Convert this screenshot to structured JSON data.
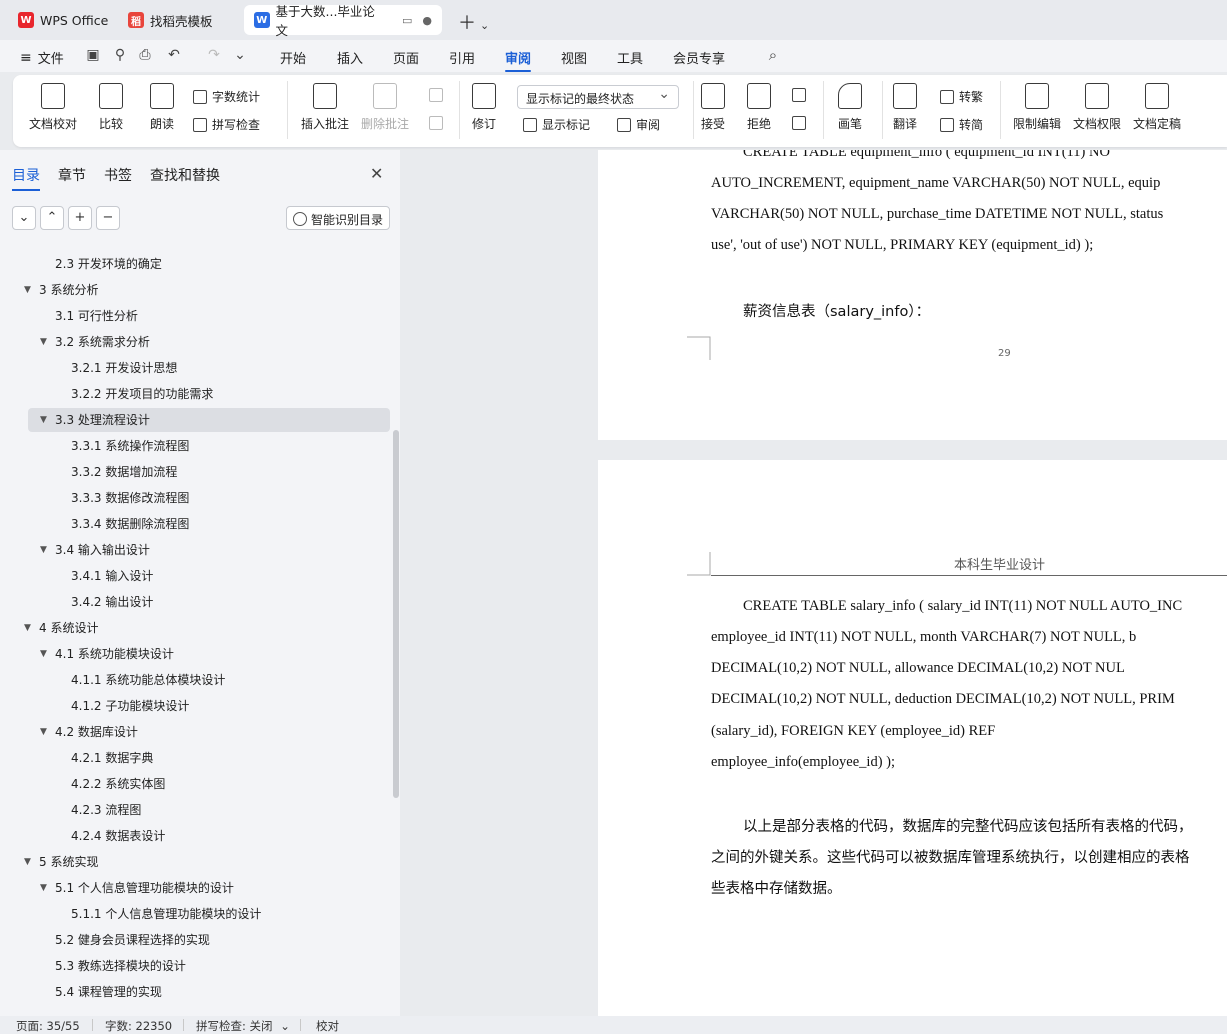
{
  "tabs": [
    {
      "label": "WPS Office",
      "logo": "wps-logo"
    },
    {
      "label": "找稻壳模板",
      "logo": "docer-logo"
    },
    {
      "label": "基于大数...毕业论文",
      "logo": "writer-logo"
    }
  ],
  "menu": {
    "file": "文件",
    "items": [
      "开始",
      "插入",
      "页面",
      "引用",
      "审阅",
      "视图",
      "工具",
      "会员专享"
    ],
    "active": "审阅"
  },
  "ribbon": {
    "doc_check": "文档校对",
    "compare": "比较",
    "read_aloud": "朗读",
    "word_count": "字数统计",
    "spell_check": "拼写检查",
    "insert_comment": "插入批注",
    "delete_comment": "删除批注",
    "revise": "修订",
    "markup_state": "显示标记的最终状态",
    "show_markup": "显示标记",
    "review": "审阅",
    "accept": "接受",
    "reject": "拒绝",
    "pen": "画笔",
    "translate": "翻译",
    "to_traditional": "转繁",
    "to_simplified": "转简",
    "restrict_edit": "限制编辑",
    "doc_permission": "文档权限",
    "doc_finalize": "文档定稿"
  },
  "sidebar": {
    "tabs": [
      "目录",
      "章节",
      "书签",
      "查找和替换"
    ],
    "smart_toc": "智能识别目录",
    "toc": [
      {
        "text": "2.3 开发环境的确定",
        "level": 2,
        "arrow": false
      },
      {
        "text": "3  系统分析",
        "level": 1,
        "arrow": true
      },
      {
        "text": "3.1 可行性分析",
        "level": 2,
        "arrow": false
      },
      {
        "text": "3.2  系统需求分析",
        "level": 2,
        "arrow": true
      },
      {
        "text": "3.2.1  开发设计思想",
        "level": 3,
        "arrow": false
      },
      {
        "text": "3.2.2  开发项目的功能需求",
        "level": 3,
        "arrow": false
      },
      {
        "text": "3.3 处理流程设计",
        "level": 2,
        "arrow": true,
        "selected": true
      },
      {
        "text": "3.3.1 系统操作流程图",
        "level": 3,
        "arrow": false
      },
      {
        "text": "3.3.2 数据增加流程",
        "level": 3,
        "arrow": false
      },
      {
        "text": "3.3.3 数据修改流程图",
        "level": 3,
        "arrow": false
      },
      {
        "text": "3.3.4 数据删除流程图",
        "level": 3,
        "arrow": false
      },
      {
        "text": "3.4 输入输出设计",
        "level": 2,
        "arrow": true
      },
      {
        "text": "3.4.1 输入设计",
        "level": 3,
        "arrow": false
      },
      {
        "text": "3.4.2 输出设计",
        "level": 3,
        "arrow": false
      },
      {
        "text": "4  系统设计",
        "level": 1,
        "arrow": true
      },
      {
        "text": "4.1 系统功能模块设计",
        "level": 2,
        "arrow": true
      },
      {
        "text": "4.1.1 系统功能总体模块设计",
        "level": 3,
        "arrow": false
      },
      {
        "text": "4.1.2 子功能模块设计",
        "level": 3,
        "arrow": false
      },
      {
        "text": "4.2 数据库设计",
        "level": 2,
        "arrow": true
      },
      {
        "text": "4.2.1 数据字典",
        "level": 3,
        "arrow": false
      },
      {
        "text": "4.2.2 系统实体图",
        "level": 3,
        "arrow": false
      },
      {
        "text": "4.2.3 流程图",
        "level": 3,
        "arrow": false
      },
      {
        "text": "4.2.4 数据表设计",
        "level": 3,
        "arrow": false
      },
      {
        "text": "5  系统实现",
        "level": 1,
        "arrow": true
      },
      {
        "text": "5.1 个人信息管理功能模块的设计",
        "level": 2,
        "arrow": true
      },
      {
        "text": "5.1.1 个人信息管理功能模块的设计",
        "level": 3,
        "arrow": false
      },
      {
        "text": "5.2 健身会员课程选择的实现",
        "level": 2,
        "arrow": false
      },
      {
        "text": "5.3 教练选择模块的设计",
        "level": 2,
        "arrow": false
      },
      {
        "text": "5.4 课程管理的实现",
        "level": 2,
        "arrow": false
      }
    ]
  },
  "document": {
    "page1_lines": [
      "CREATE    TABLE    equipment_info    (    equipment_id    INT(11)    NO",
      "AUTO_INCREMENT, equipment_name VARCHAR(50) NOT NULL, equip",
      "VARCHAR(50) NOT NULL, purchase_time DATETIME NOT NULL, status",
      "use', 'out of use') NOT NULL, PRIMARY KEY (equipment_id) );"
    ],
    "salary_heading": "薪资信息表（salary_info）：",
    "page_number": "29",
    "header": "本科生毕业设计",
    "page2_lines": [
      "CREATE TABLE salary_info ( salary_id INT(11) NOT NULL AUTO_INC",
      "employee_id  INT(11)  NOT  NULL,  month  VARCHAR(7)  NOT  NULL,  b",
      "DECIMAL(10,2)   NOT   NULL,   allowance   DECIMAL(10,2)   NOT   NUL",
      "DECIMAL(10,2) NOT NULL, deduction DECIMAL(10,2) NOT NULL, PRIM",
      "(salary_id),          FOREIGN          KEY          (employee_id)          REF",
      "employee_info(employee_id) );"
    ],
    "summary_lines": [
      "以上是部分表格的代码，数据库的完整代码应该包括所有表格的代码，",
      "之间的外键关系。这些代码可以被数据库管理系统执行，以创建相应的表格",
      "些表格中存储数据。"
    ]
  },
  "status": {
    "page": "页面: 35/55",
    "words": "字数: 22350",
    "spell": "拼写检查: 关闭",
    "proof": "校对"
  }
}
